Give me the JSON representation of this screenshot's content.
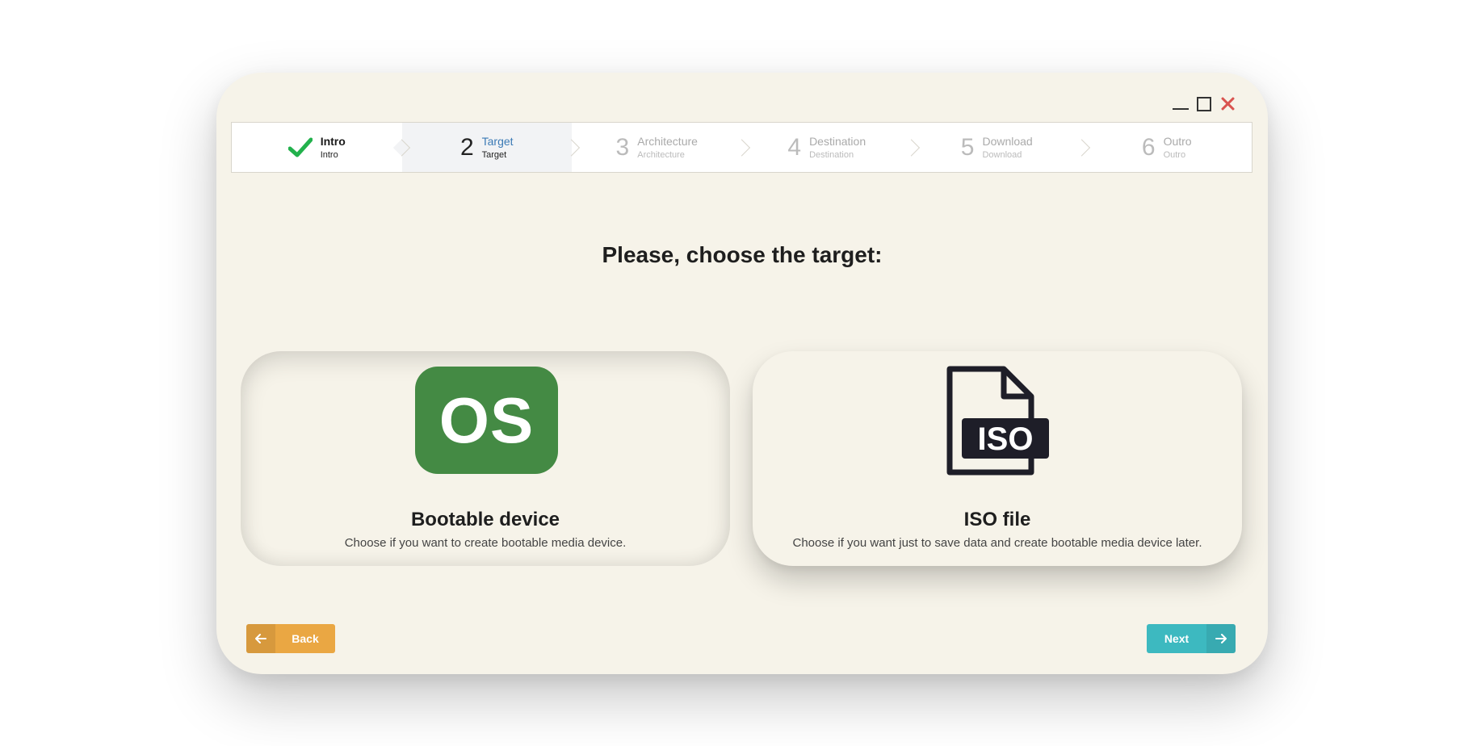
{
  "window": {
    "controls": [
      "minimize",
      "maximize",
      "close"
    ]
  },
  "steps": [
    {
      "num": "",
      "title": "Intro",
      "subtitle": "Intro",
      "state": "done"
    },
    {
      "num": "2",
      "title": "Target",
      "subtitle": "Target",
      "state": "active"
    },
    {
      "num": "3",
      "title": "Architecture",
      "subtitle": "Architecture",
      "state": "pending"
    },
    {
      "num": "4",
      "title": "Destination",
      "subtitle": "Destination",
      "state": "pending"
    },
    {
      "num": "5",
      "title": "Download",
      "subtitle": "Download",
      "state": "pending"
    },
    {
      "num": "6",
      "title": "Outro",
      "subtitle": "Outro",
      "state": "pending"
    }
  ],
  "heading": "Please, choose the target:",
  "options": {
    "bootable": {
      "icon_text": "OS",
      "title": "Bootable device",
      "description": "Choose if you want to create bootable media device.",
      "selected": true,
      "icon_color": "#448a44"
    },
    "iso": {
      "icon_text": "ISO",
      "title": "ISO file",
      "description": "Choose if you want just to save data and create bootable media device later.",
      "selected": false
    }
  },
  "buttons": {
    "back_label": "Back",
    "next_label": "Next"
  },
  "colors": {
    "background": "#f6f3e9",
    "back_button": "#eaa743",
    "next_button": "#3db9c0",
    "active_step": "#3b7ab5",
    "check": "#22b14c",
    "close": "#d9534f"
  },
  "icons": {
    "done_step": "check-icon",
    "back_button": "arrow-left-icon",
    "next_button": "arrow-right-icon"
  }
}
